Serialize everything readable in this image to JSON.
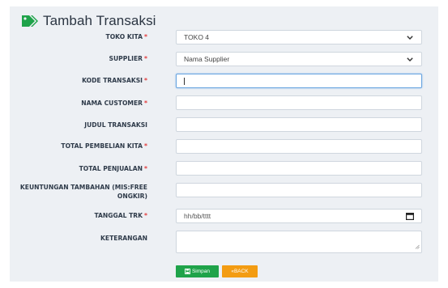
{
  "title": "Tambah Transaksi",
  "fields": {
    "toko_kita": {
      "label": "TOKO KITA",
      "value": "TOKO 4"
    },
    "supplier": {
      "label": "SUPPLIER",
      "placeholder": "Nama Supplier"
    },
    "kode_transaksi": {
      "label": "KODE TRANSAKSI",
      "value": ""
    },
    "nama_customer": {
      "label": "NAMA CUSTOMER",
      "value": ""
    },
    "judul_transaksi": {
      "label": "JUDUL TRANSAKSI",
      "value": ""
    },
    "total_pembelian": {
      "label": "TOTAL PEMBELIAN KITA",
      "value": ""
    },
    "total_penjualan": {
      "label": "TOTAL PENJUALAN",
      "value": ""
    },
    "keuntungan": {
      "label_line1": "KEUNTUNGAN TAMBAHAN (MIS:FREE",
      "label_line2": "ONGKIR)",
      "value": ""
    },
    "tanggal_trk": {
      "label": "TANGGAL TRK",
      "placeholder": "hh/bb/tttt"
    },
    "keterangan": {
      "label": "KETERANGAN",
      "value": ""
    }
  },
  "required_mark": "*",
  "buttons": {
    "save": "Simpan",
    "back": "«BACK"
  },
  "colors": {
    "save": "#1fa34a",
    "back": "#f39c12",
    "required": "#e23b3b",
    "tag_icon": "#1fa34a"
  },
  "icons": {
    "title": "tag-icon",
    "select": "chevron-down-icon",
    "date": "calendar-icon",
    "save": "floppy-disk-icon"
  }
}
